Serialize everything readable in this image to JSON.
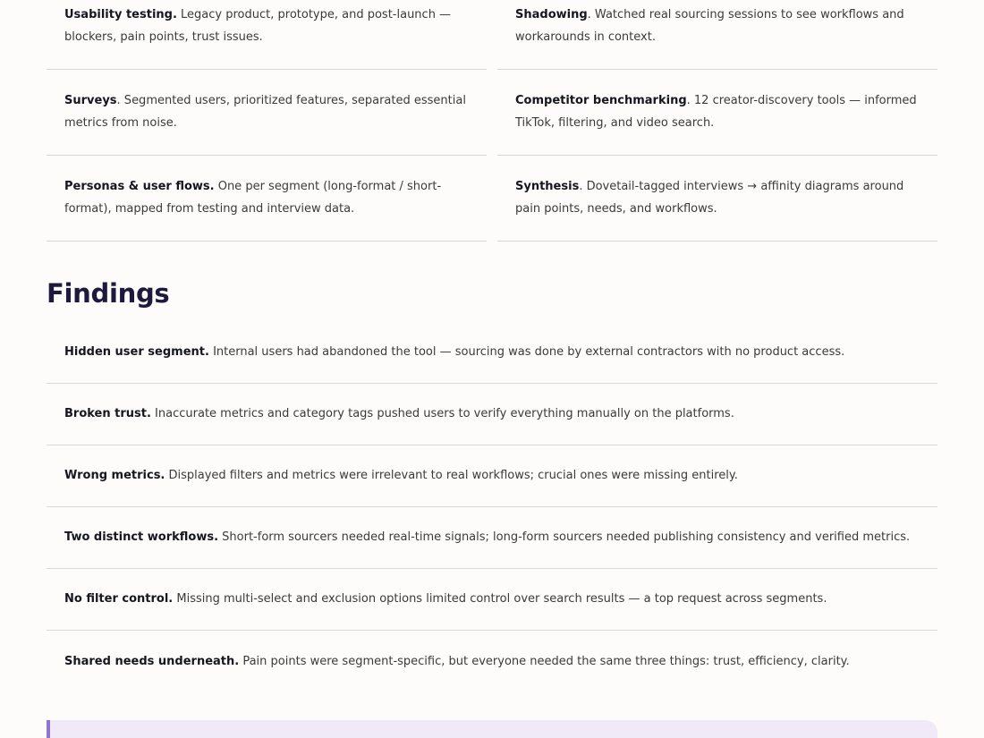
{
  "methods": [
    {
      "term": "Usability testing.",
      "text": " Legacy product, prototype, and post-launch — blockers, pain points, trust issues."
    },
    {
      "term": "Shadowing",
      "text": ". Watched real sourcing sessions to see workflows and workarounds in context."
    },
    {
      "term": "Surveys",
      "text": ". Segmented users, prioritized features, separated essential metrics from noise."
    },
    {
      "term": "Competitor benchmarking",
      "text": ". 12 creator-discovery tools — informed TikTok, filtering, and video search."
    },
    {
      "term": "Personas & user flows.",
      "text": " One per segment (long-format / short-format), mapped from testing and interview data."
    },
    {
      "term": "Synthesis",
      "text": ". Dovetail-tagged interviews → affinity diagrams around pain points, needs, and workflows."
    }
  ],
  "findings": {
    "title": "Findings",
    "items": [
      {
        "term": "Hidden user segment.",
        "text": " Internal users had abandoned the tool — sourcing was done by external contractors with no product access."
      },
      {
        "term": "Broken trust.",
        "text": " Inaccurate metrics and category tags pushed users to verify everything manually on the platforms."
      },
      {
        "term": "Wrong metrics.",
        "text": " Displayed filters and metrics were irrelevant to real workflows; crucial ones were missing entirely."
      },
      {
        "term": "Two distinct workflows.",
        "text": " Short-form sourcers needed real-time signals; long-form sourcers needed publishing consistency and verified metrics."
      },
      {
        "term": "No filter control.",
        "text": " Missing multi-select and exclusion options limited control over search results — a top request across segments."
      },
      {
        "term": "Shared needs underneath.",
        "text": " Pain points were segment-specific, but everyone needed the same three things: trust, efficiency, clarity."
      }
    ]
  },
  "colors": {
    "heading": "#1d1a3d",
    "callout_bg": "#efe9f8",
    "callout_accent": "#8e73d3"
  }
}
